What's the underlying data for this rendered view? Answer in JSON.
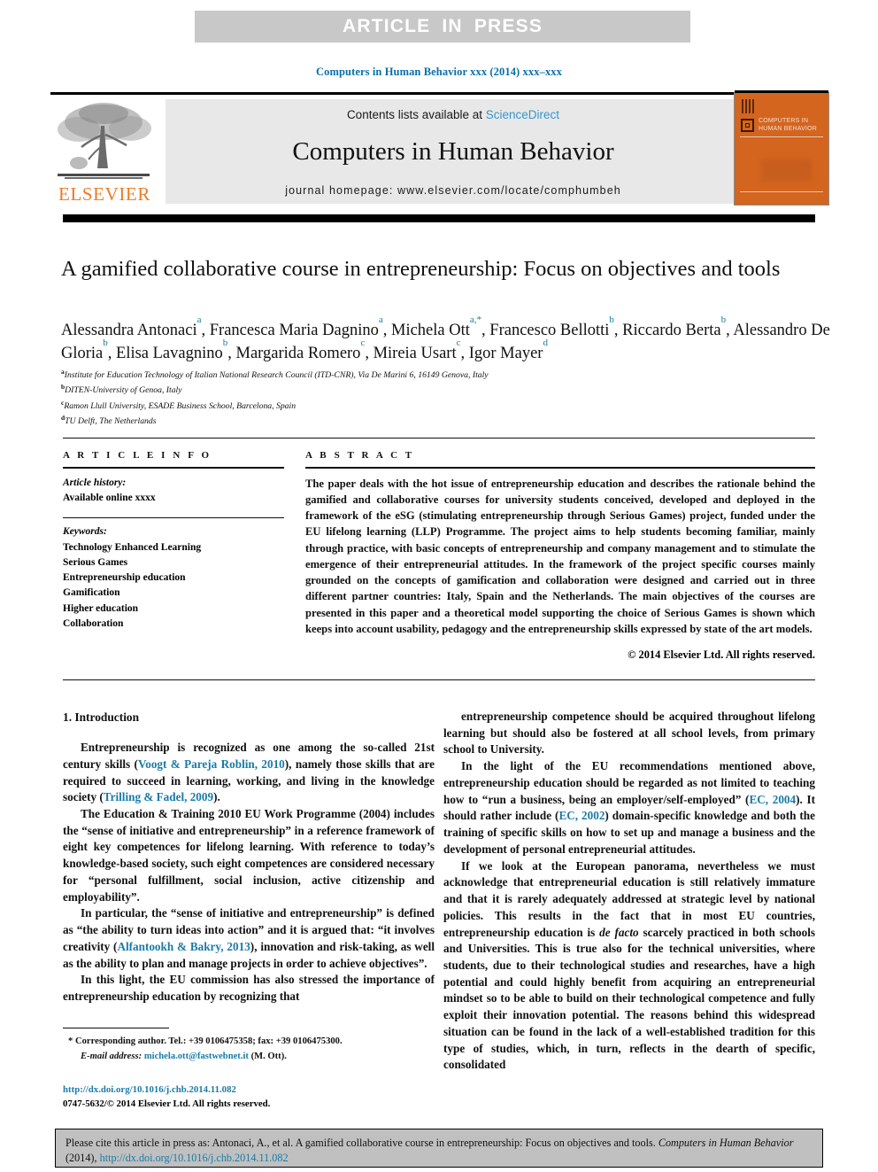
{
  "banner": {
    "text": "ARTICLE  IN  PRESS",
    "bg_color": "#c8c8c8",
    "text_color": "#ffffff"
  },
  "running_head": "Computers in Human Behavior xxx (2014) xxx–xxx",
  "masthead": {
    "contents_prefix": "Contents lists available at ",
    "sciencedirect": "ScienceDirect",
    "journal_title": "Computers in Human Behavior",
    "homepage": "journal homepage: www.elsevier.com/locate/comphumbeh",
    "publisher": "ELSEVIER",
    "publisher_color": "#eb7b25",
    "cover_name": "COMPUTERS IN\nHUMAN BEHAVIOR",
    "cover_color": "#d4651f",
    "link_color": "#3399cc"
  },
  "article": {
    "title": "A gamified collaborative course in entrepreneurship: Focus on objectives and tools",
    "authors": [
      {
        "name": "Alessandra Antonaci",
        "sup": "a",
        "sep": ", "
      },
      {
        "name": "Francesca Maria Dagnino",
        "sup": "a",
        "sep": ", "
      },
      {
        "name": "Michela Ott",
        "sup": "a,*",
        "sep": ", "
      },
      {
        "name": "Francesco Bellotti",
        "sup": "b",
        "sep": ", "
      },
      {
        "name": "Riccardo Berta",
        "sup": "b",
        "sep": ", "
      },
      {
        "name": "Alessandro De Gloria",
        "sup": "b",
        "sep": ", "
      },
      {
        "name": "Elisa Lavagnino",
        "sup": "b",
        "sep": ", "
      },
      {
        "name": "Margarida Romero",
        "sup": "c",
        "sep": ", "
      },
      {
        "name": "Mireia Usart",
        "sup": "c",
        "sep": ", "
      },
      {
        "name": "Igor Mayer",
        "sup": "d",
        "sep": ""
      }
    ],
    "affiliations": [
      {
        "sup": "a",
        "text": "Institute for Education Technology of Italian National Research Council (ITD-CNR), Via De Marini 6, 16149 Genova, Italy"
      },
      {
        "sup": "b",
        "text": "DITEN-University of Genoa, Italy"
      },
      {
        "sup": "c",
        "text": "Ramon Llull University, ESADE Business School, Barcelona, Spain"
      },
      {
        "sup": "d",
        "text": "TU Delft, The Netherlands"
      }
    ]
  },
  "article_info": {
    "heading": "A R T I C L E   I N F O",
    "history_label": "Article history:",
    "history_value": "Available online xxxx",
    "keywords_label": "Keywords:",
    "keywords": [
      "Technology Enhanced Learning",
      "Serious Games",
      "Entrepreneurship education",
      "Gamification",
      "Higher education",
      "Collaboration"
    ]
  },
  "abstract": {
    "heading": "A B S T R A C T",
    "text": "The paper deals with the hot issue of entrepreneurship education and describes the rationale behind the gamified and collaborative courses for university students conceived, developed and deployed in the framework of the eSG (stimulating entrepreneurship through Serious Games) project, funded under the EU lifelong learning (LLP) Programme. The project aims to help students becoming familiar, mainly through practice, with basic concepts of entrepreneurship and company management and to stimulate the emergence of their entrepreneurial attitudes. In the framework of the project specific courses mainly grounded on the concepts of gamification and collaboration were designed and carried out in three different partner countries: Italy, Spain and the Netherlands. The main objectives of the courses are presented in this paper and a theoretical model supporting the choice of Serious Games is shown which keeps into account usability, pedagogy and the entrepreneurship skills expressed by state of the art models.",
    "copyright": "© 2014 Elsevier Ltd. All rights reserved."
  },
  "body": {
    "section_heading": "1. Introduction",
    "left_paragraphs": [
      "Entrepreneurship is recognized as one among the so-called 21st century skills (<a class=\"ref\">Voogt &amp; Pareja Roblin, 2010</a>), namely those skills that are required to succeed in learning, working, and living in the knowledge society (<a class=\"ref\">Trilling &amp; Fadel, 2009</a>).",
      "The Education &amp; Training 2010 EU Work Programme (2004) includes the &ldquo;sense of initiative and entrepreneurship&rdquo; in a reference framework of eight key competences for lifelong learning. With reference to today&rsquo;s knowledge-based society, such eight competences are considered necessary for &ldquo;personal fulfillment, social inclusion, active citizenship and employability&rdquo;.",
      "In particular, the &ldquo;sense of initiative and entrepreneurship&rdquo; is defined as &ldquo;the ability to turn ideas into action&rdquo; and it is argued that: &ldquo;it involves creativity (<a class=\"ref\">Alfantookh &amp; Bakry, 2013</a>), innovation and risk-taking, as well as the ability to plan and manage projects in order to achieve objectives&rdquo;.",
      "In this light, the EU commission has also stressed the importance of entrepreneurship education by recognizing that"
    ],
    "right_paragraphs": [
      "entrepreneurship competence should be acquired throughout lifelong learning but should also be fostered at all school levels, from primary school to University.",
      "In the light of the EU recommendations mentioned above, entrepreneurship education should be regarded as not limited to teaching how to &ldquo;run a business, being an employer/self-employed&rdquo; (<a class=\"ref\">EC, 2004</a>). It should rather include (<a class=\"ref\">EC, 2002</a>) domain-specific knowledge and both the training of specific skills on how to set up and manage a business and the development of personal entrepreneurial attitudes.",
      "If we look at the European panorama, nevertheless we must acknowledge that entrepreneurial education is still relatively immature and that it is rarely adequately addressed at strategic level by national policies. This results in the fact that in most EU countries, entrepreneurship education is <i>de facto</i> scarcely practiced in both schools and Universities. This is true also for the technical universities, where students, due to their technological studies and researches, have a high potential and could highly benefit from acquiring an entrepreneurial mindset so to be able to build on their technological competence and fully exploit their innovation potential. The reasons behind this widespread situation can be found in the lack of a well-established tradition for this type of studies, which, in turn, reflects in the dearth of specific, consolidated"
    ]
  },
  "footnote": {
    "marker": "*",
    "corresponding": "Corresponding author. Tel.: +39 0106475358; fax: +39 0106475300.",
    "email_label": "E-mail address:",
    "email": "michela.ott@fastwebnet.it",
    "email_owner": "(M. Ott)."
  },
  "doi_block": {
    "doi_url": "http://dx.doi.org/10.1016/j.chb.2014.11.082",
    "issn_line": "0747-5632/© 2014 Elsevier Ltd. All rights reserved."
  },
  "citation": {
    "prefix": "Please cite this article in press as: Antonaci, A., et al. A gamified collaborative course in entrepreneurship: Focus on objectives and tools. ",
    "journal": "Computers in Human Behavior",
    "year": " (2014), ",
    "link": "http://dx.doi.org/10.1016/j.chb.2014.11.082"
  }
}
